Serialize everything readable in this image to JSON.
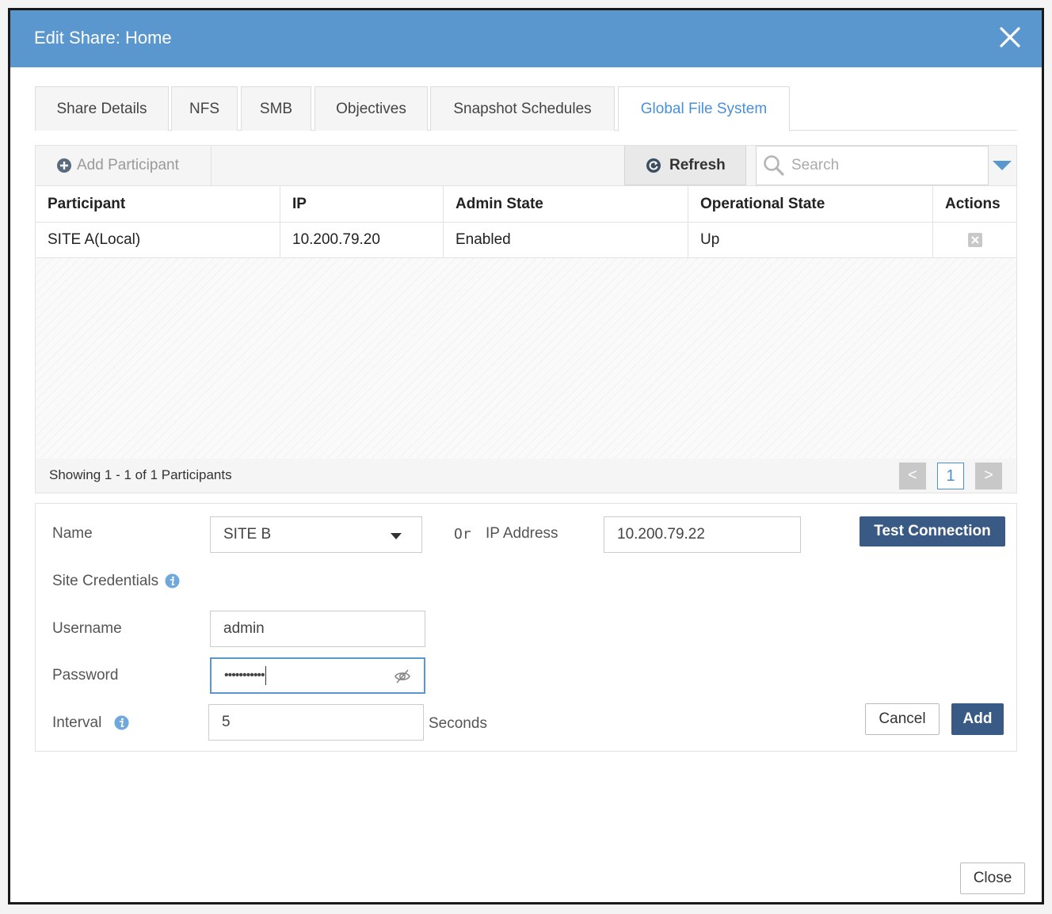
{
  "dialog": {
    "title": "Edit Share: Home",
    "close_label": "Close"
  },
  "tabs": [
    {
      "label": "Share Details",
      "active": false
    },
    {
      "label": "NFS",
      "active": false
    },
    {
      "label": "SMB",
      "active": false
    },
    {
      "label": "Objectives",
      "active": false
    },
    {
      "label": "Snapshot Schedules",
      "active": false
    },
    {
      "label": "Global File System",
      "active": true
    }
  ],
  "toolbar": {
    "add_participant_label": "Add Participant",
    "refresh_label": "Refresh",
    "search_placeholder": "Search"
  },
  "grid": {
    "columns": [
      "Participant",
      "IP",
      "Admin State",
      "Operational State",
      "Actions"
    ],
    "rows": [
      {
        "participant": "SITE A(Local)",
        "ip": "10.200.79.20",
        "admin_state": "Enabled",
        "operational_state": "Up"
      }
    ],
    "status": "Showing 1 - 1 of 1 Participants",
    "pager": {
      "prev": "<",
      "current": "1",
      "next": ">"
    }
  },
  "form": {
    "name_label": "Name",
    "name_value": "SITE B",
    "or_label": "Or",
    "ip_label": "IP Address",
    "ip_value": "10.200.79.22",
    "test_connection_label": "Test Connection",
    "site_credentials_label": "Site Credentials",
    "username_label": "Username",
    "username_value": "admin",
    "password_label": "Password",
    "password_value": "•••••••••••",
    "interval_label": "Interval",
    "interval_value": "5",
    "seconds_label": "Seconds",
    "cancel_label": "Cancel",
    "add_label": "Add"
  },
  "colors": {
    "titlebar": "#5b97cf",
    "active_tab": "#4a90d9",
    "primary_button": "#3a5a86",
    "info_icon": "#6fa8dc"
  }
}
